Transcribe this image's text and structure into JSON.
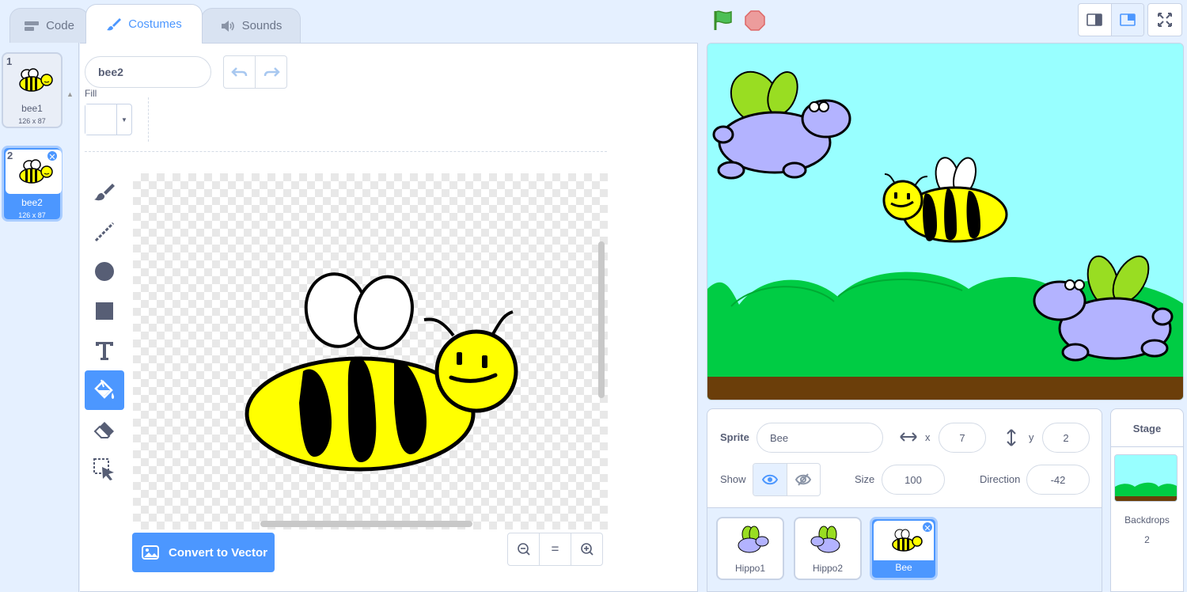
{
  "tabs": [
    {
      "label": "Code",
      "icon": "code-icon",
      "active": false
    },
    {
      "label": "Costumes",
      "icon": "brush-icon",
      "active": true
    },
    {
      "label": "Sounds",
      "icon": "speaker-icon",
      "active": false
    }
  ],
  "costumes": [
    {
      "number": "1",
      "name": "bee1",
      "dims": "126 x 87",
      "selected": false
    },
    {
      "number": "2",
      "name": "bee2",
      "dims": "126 x 87",
      "selected": true
    }
  ],
  "editor": {
    "costume_name": "bee2",
    "fill_label": "Fill",
    "fill_color": "#ffffff",
    "tools": [
      "brush-icon",
      "line-icon",
      "circle-icon",
      "rectangle-icon",
      "text-icon",
      "fill-bucket-icon",
      "eraser-icon",
      "select-icon"
    ],
    "active_tool": "fill-bucket-icon",
    "convert_label": "Convert to Vector",
    "zoom_reset": "="
  },
  "sprite_info": {
    "sprite_label": "Sprite",
    "sprite_name": "Bee",
    "x_label": "x",
    "x_value": "7",
    "y_label": "y",
    "y_value": "2",
    "show_label": "Show",
    "size_label": "Size",
    "size_value": "100",
    "direction_label": "Direction",
    "direction_value": "-42"
  },
  "sprites": [
    {
      "name": "Hippo1",
      "selected": false
    },
    {
      "name": "Hippo2",
      "selected": false
    },
    {
      "name": "Bee",
      "selected": true
    }
  ],
  "stage_panel": {
    "title": "Stage",
    "backdrops_label": "Backdrops",
    "backdrops_count": "2"
  },
  "colors": {
    "accent": "#4c97ff",
    "panel_bg": "#e5f0ff",
    "sky": "#98ffff",
    "grass": "#00cc44",
    "ground": "#6b3e0a",
    "bee_yellow": "#ffff00",
    "hippo_purple": "#b3b3ff",
    "wing_green": "#99dd22"
  }
}
